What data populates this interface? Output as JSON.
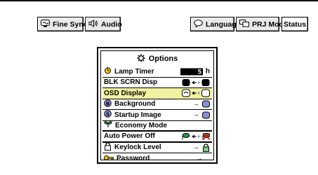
{
  "tabs": {
    "fine_sync": "Fine Sync",
    "audio": "Audio",
    "language": "Language",
    "prj_mode": "PRJ Mode",
    "status": "Status"
  },
  "panel": {
    "title": "Options",
    "items": [
      {
        "label": "Lamp Timer",
        "value": "5",
        "unit": "h"
      },
      {
        "label": "BLK SCRN Disp"
      },
      {
        "label": "OSD Display"
      },
      {
        "label": "Background"
      },
      {
        "label": "Startup Image"
      },
      {
        "label": "Economy Mode"
      },
      {
        "label": "Auto Power Off"
      },
      {
        "label": "Keylock Level"
      },
      {
        "label": "Password"
      }
    ]
  },
  "colors": {
    "selected_row": "#f2f2a0",
    "tab_bg": "#e9e9e9"
  }
}
